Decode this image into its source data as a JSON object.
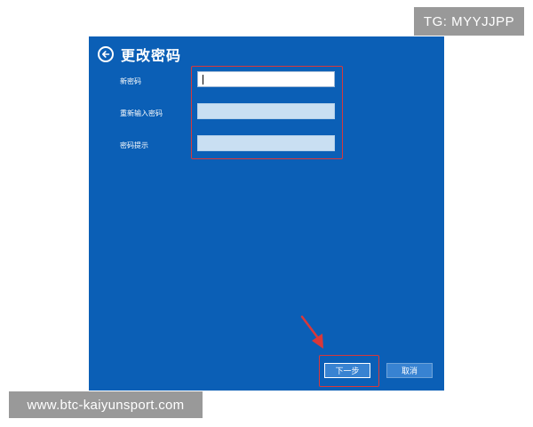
{
  "watermark": {
    "tg_label": "TG: MYYJJPP",
    "url_label": "www.btc-kaiyunsport.com"
  },
  "dialog": {
    "title": "更改密码",
    "background_color": "#0b5fb6",
    "back_icon": "back-arrow-circle-icon",
    "fields": [
      {
        "label": "新密码",
        "value": ""
      },
      {
        "label": "重新输入密码",
        "value": ""
      },
      {
        "label": "密码提示",
        "value": ""
      }
    ],
    "buttons": {
      "next_label": "下一步",
      "cancel_label": "取消"
    }
  },
  "annotations": {
    "highlight_color": "#d9383a",
    "arrow_icon": "pointer-arrow-icon"
  }
}
